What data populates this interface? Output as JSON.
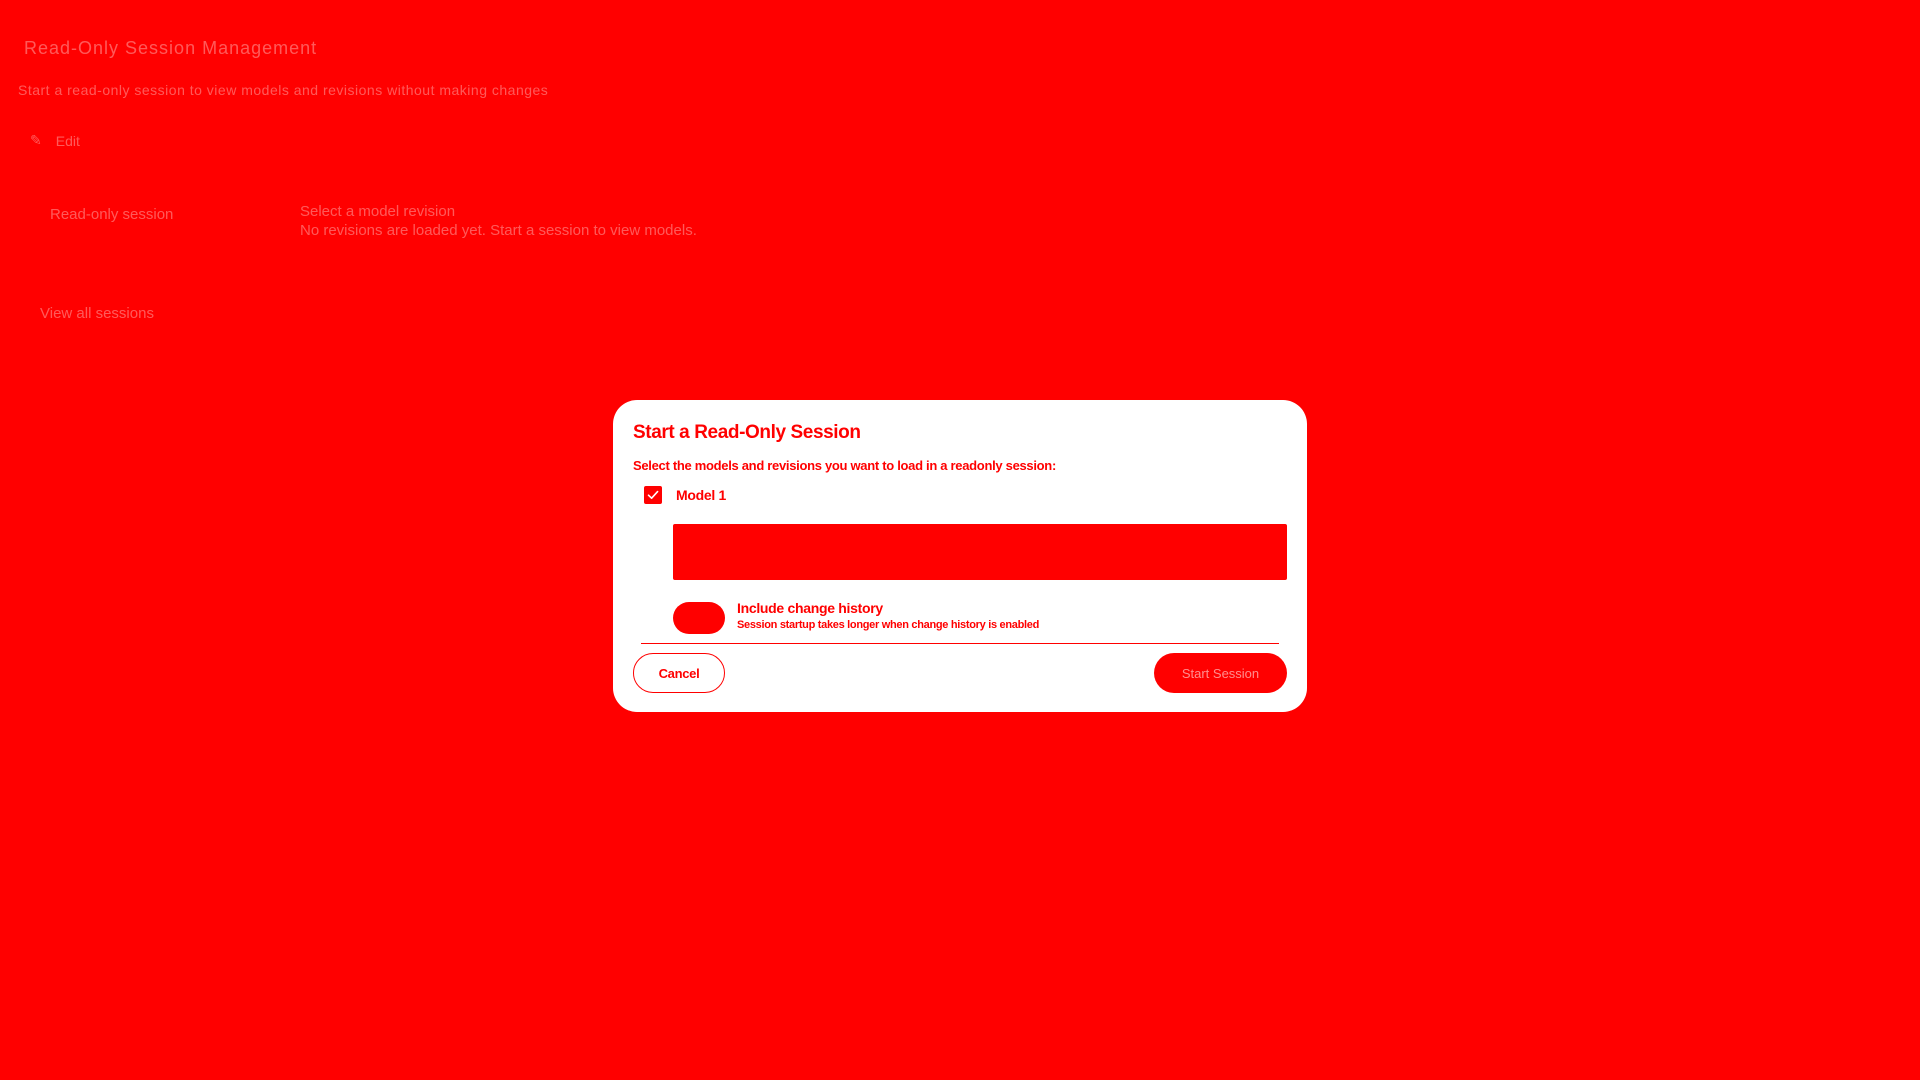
{
  "background": {
    "title": "Read-Only Session Management",
    "subtitle": "Start a read-only session to view models and revisions without making changes",
    "edit_label": "Edit",
    "row_label": "Read-only session",
    "detail_line1": "Select a model revision",
    "detail_line2": "No revisions are loaded yet. Start a session to view models.",
    "link_text": "View all sessions"
  },
  "dialog": {
    "title": "Start a Read-Only Session",
    "description": "Select the models and revisions you want to load in a readonly session:",
    "model": {
      "label": "Model 1",
      "checked": true
    },
    "revision_select": {
      "value": ""
    },
    "change_history": {
      "label": "Include change history",
      "hint": "Session startup takes longer when change history is enabled",
      "enabled": false
    },
    "cancel_label": "Cancel",
    "start_label": "Start Session"
  },
  "colors": {
    "overlay": "#ff0000",
    "dialog_bg": "#ffffff",
    "accent": "#ff0000"
  }
}
